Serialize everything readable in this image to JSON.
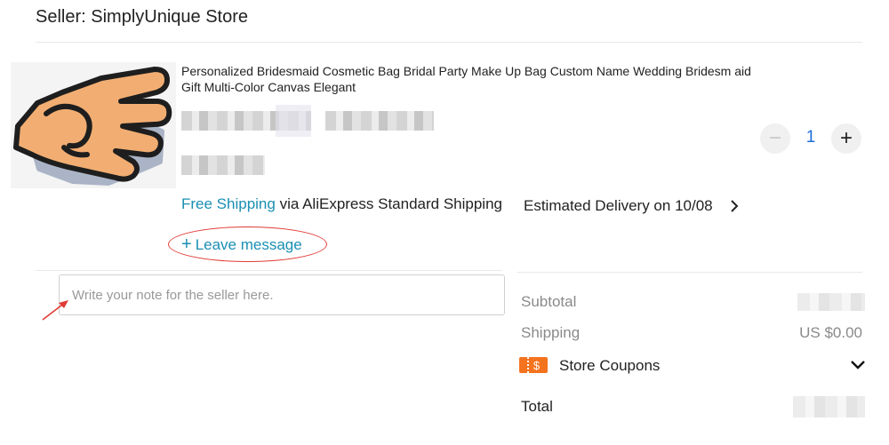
{
  "seller": {
    "title": "Seller: SimplyUnique Store"
  },
  "product": {
    "image_icon": "pointing-hand-icon",
    "title": "Personalized Bridesmaid Cosmetic Bag Bridal Party Make Up Bag Custom Name Wedding Bridesm aid Gift Multi-Color Canvas Elegant",
    "quantity": "1",
    "decrease_label": "−",
    "increase_label": "+"
  },
  "shipping": {
    "free_label": "Free Shipping",
    "method": " via AliExpress Standard Shipping",
    "estimate": "Estimated Delivery on 10/08"
  },
  "message": {
    "leave_plus": "+",
    "leave_label": "Leave message",
    "placeholder": "Write your note for the seller here."
  },
  "summary": {
    "subtotal_label": "Subtotal",
    "shipping_label": "Shipping",
    "shipping_value": "US $0.00",
    "coupon_symbol": "$",
    "coupons_label": "Store Coupons",
    "total_label": "Total"
  },
  "colors": {
    "accent_blue": "#1a8fb3",
    "quantity_blue": "#1c6fd8",
    "coupon_orange": "#f4731f",
    "annotation_red": "#e03b35"
  }
}
